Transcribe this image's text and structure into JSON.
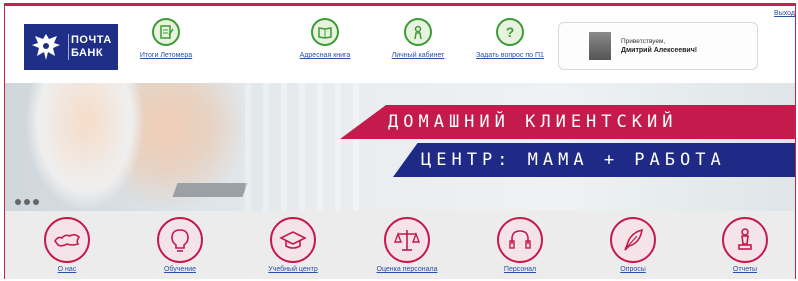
{
  "header": {
    "logout_label": "Выход",
    "brand_line1": "ПОЧТА",
    "brand_line2": "БАНК"
  },
  "toplinks": [
    {
      "label": "Итоги Летомера",
      "icon": "notepad-pencil-icon"
    },
    {
      "label": "Адресная книга",
      "icon": "address-book-icon"
    },
    {
      "label": "Личный кабинет",
      "icon": "person-icon"
    },
    {
      "label": "Задать вопрос по П1",
      "icon": "question-mark-icon"
    }
  ],
  "user": {
    "greeting": "Приветствуем,",
    "name": "Дмитрий Алексеевич!"
  },
  "banner": {
    "line1": "ДОМАШНИЙ КЛИЕНТСКИЙ",
    "line2": "ЦЕНТР: МАМА + РАБОТА"
  },
  "menu": [
    {
      "label": "О нас",
      "icon": "russia-map-icon"
    },
    {
      "label": "Обучение",
      "icon": "lightbulb-icon"
    },
    {
      "label": "Учебный центр",
      "icon": "graduation-cap-icon"
    },
    {
      "label": "Оценка персонала",
      "icon": "scales-icon"
    },
    {
      "label": "Персонал",
      "icon": "headset-icon"
    },
    {
      "label": "Опросы",
      "icon": "feather-pen-icon"
    },
    {
      "label": "Отчеты",
      "icon": "chess-piece-icon"
    }
  ],
  "colors": {
    "brand_red": "#c41a4c",
    "brand_blue": "#1e2a86",
    "link_blue": "#2a4fa8",
    "icon_green": "#3d9b35"
  }
}
